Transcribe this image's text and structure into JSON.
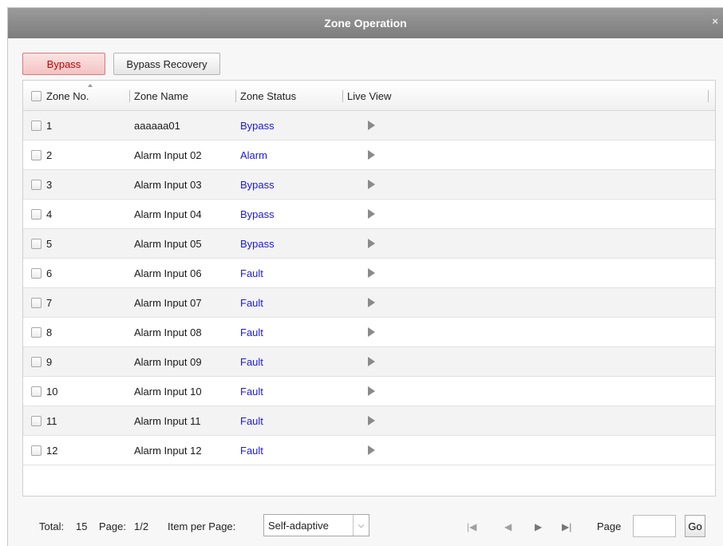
{
  "dialog": {
    "title": "Zone Operation",
    "close_glyph": "×"
  },
  "toolbar": {
    "bypass_label": "Bypass",
    "bypass_recovery_label": "Bypass Recovery"
  },
  "table": {
    "columns": [
      "Zone No.",
      "Zone Name",
      "Zone Status",
      "Live View"
    ],
    "rows": [
      {
        "no": "1",
        "name": "aaaaaa01",
        "status": "Bypass"
      },
      {
        "no": "2",
        "name": "Alarm Input 02",
        "status": "Alarm"
      },
      {
        "no": "3",
        "name": "Alarm Input 03",
        "status": "Bypass"
      },
      {
        "no": "4",
        "name": "Alarm Input 04",
        "status": "Bypass"
      },
      {
        "no": "5",
        "name": "Alarm Input 05",
        "status": "Bypass"
      },
      {
        "no": "6",
        "name": "Alarm Input 06",
        "status": "Fault"
      },
      {
        "no": "7",
        "name": "Alarm Input 07",
        "status": "Fault"
      },
      {
        "no": "8",
        "name": "Alarm Input 08",
        "status": "Fault"
      },
      {
        "no": "9",
        "name": "Alarm Input 09",
        "status": "Fault"
      },
      {
        "no": "10",
        "name": "Alarm Input 10",
        "status": "Fault"
      },
      {
        "no": "11",
        "name": "Alarm Input 11",
        "status": "Fault"
      },
      {
        "no": "12",
        "name": "Alarm Input 12",
        "status": "Fault"
      }
    ],
    "live_view_icon": "play-icon"
  },
  "footer": {
    "total_label": "Total:",
    "total_value": "15",
    "page_label": "Page:",
    "page_value": "1/2",
    "item_per_page_label": "Item per Page:",
    "item_per_page_value": "Self-adaptive",
    "page_input_label": "Page",
    "page_input_value": "",
    "go_label": "Go"
  },
  "colors": {
    "status_text": "#1a1ad6",
    "bypass_button_text": "#c00000",
    "title_bar": "#8c8c8c"
  }
}
